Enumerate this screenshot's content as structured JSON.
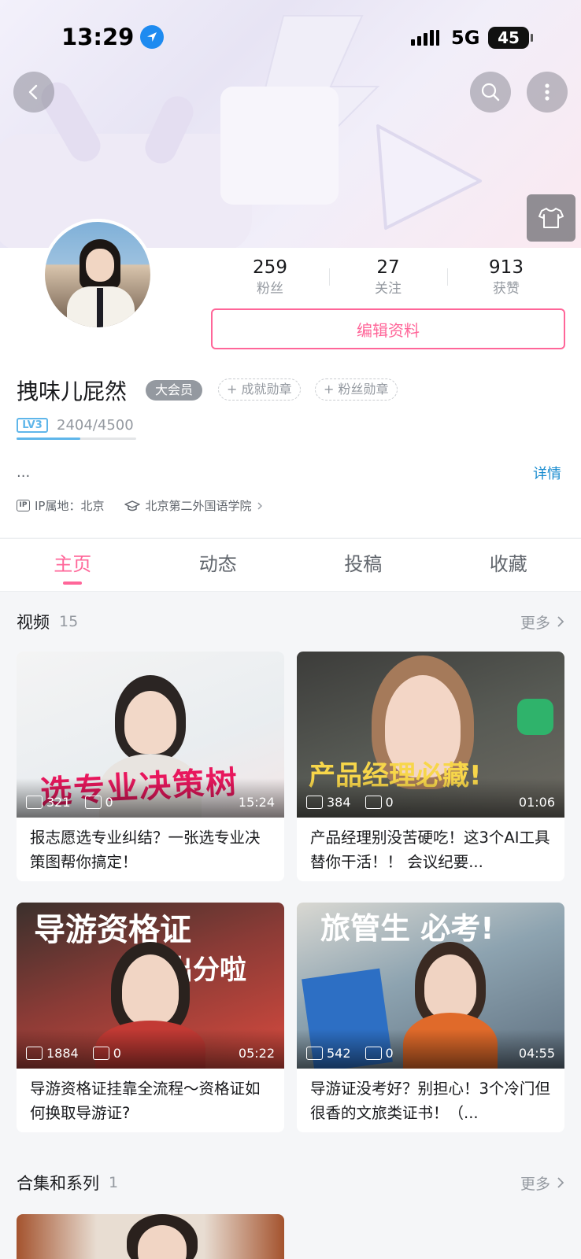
{
  "status_bar": {
    "time": "13:29",
    "network": "5G",
    "battery": "45"
  },
  "profile": {
    "stats": [
      {
        "value": "259",
        "label": "粉丝"
      },
      {
        "value": "27",
        "label": "关注"
      },
      {
        "value": "913",
        "label": "获赞"
      }
    ],
    "edit_label": "编辑资料",
    "username": "拽味儿屁然",
    "vip_label": "大会员",
    "medals": [
      "+ 成就勋章",
      "+ 粉丝勋章"
    ],
    "level": "LV3",
    "exp_text": "2404/4500",
    "exp_fraction": 0.534,
    "bio": "...",
    "detail_label": "详情",
    "ip_icon": "IP",
    "ip_label": "IP属地：北京",
    "school": "北京第二外国语学院"
  },
  "tabs": [
    "主页",
    "动态",
    "投稿",
    "收藏"
  ],
  "videos_section": {
    "title": "视频",
    "count": "15",
    "more": "更多"
  },
  "videos": [
    {
      "title": "报志愿选专业纠结？一张选专业决策图帮你搞定！",
      "plays": "321",
      "comments": "0",
      "duration": "15:24"
    },
    {
      "title": "产品经理别没苦硬吃！这3个AI工具替你干活！！ 会议纪要...",
      "plays": "384",
      "comments": "0",
      "duration": "01:06"
    },
    {
      "title": "导游资格证挂靠全流程～资格证如何换取导游证?",
      "plays": "1884",
      "comments": "0",
      "duration": "05:22"
    },
    {
      "title": "导游证没考好？别担心！3个冷门但很香的文旅类证书！（...",
      "plays": "542",
      "comments": "0",
      "duration": "04:55"
    }
  ],
  "collections_section": {
    "title": "合集和系列",
    "count": "1",
    "more": "更多"
  },
  "colors": {
    "accent": "#ff6699",
    "level": "#5fb6ea",
    "link": "#178bcf"
  }
}
